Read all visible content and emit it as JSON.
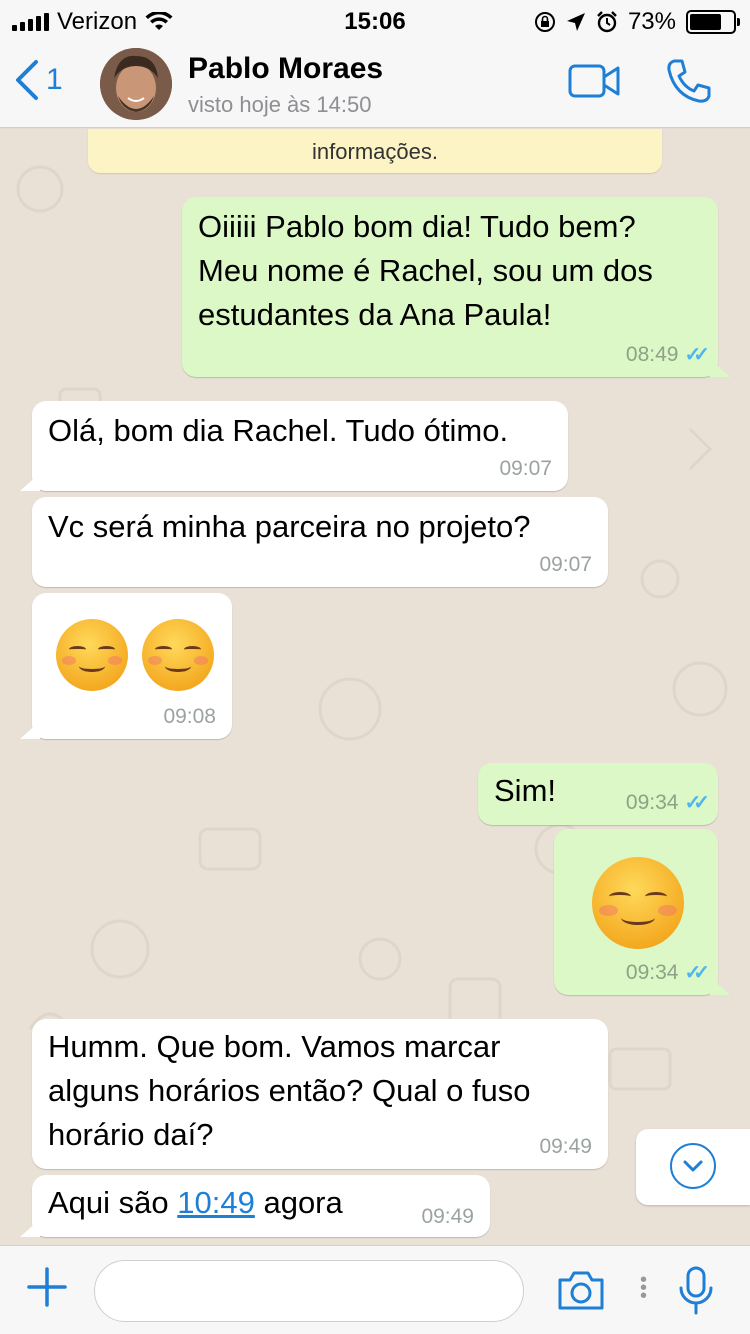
{
  "status_bar": {
    "carrier": "Verizon",
    "time": "15:06",
    "battery": "73%",
    "battery_level": 0.73
  },
  "header": {
    "back_count": "1",
    "contact_name": "Pablo Moraes",
    "contact_status": "visto hoje às 14:50"
  },
  "chat": {
    "system_message": "informações.",
    "messages": [
      {
        "dir": "out",
        "lines": [
          "Oiiiii Pablo bom dia! Tudo bem?",
          "Meu nome é Rachel, sou um dos",
          "estudantes da Ana Paula!"
        ],
        "time": "08:49"
      },
      {
        "dir": "in",
        "text": "Olá, bom dia Rachel. Tudo ótimo.",
        "time": "09:07"
      },
      {
        "dir": "in",
        "text": "Vc será minha parceira no projeto?",
        "time": "09:07"
      },
      {
        "dir": "in",
        "emoji": "smiling-face-with-blush x2",
        "time": "09:08"
      },
      {
        "dir": "out",
        "text": "Sim!",
        "time": "09:34"
      },
      {
        "dir": "out",
        "emoji": "smiling-face-with-blush",
        "time": "09:34"
      },
      {
        "dir": "in",
        "lines": [
          "Humm. Que bom. Vamos marcar",
          "alguns horários então? Qual o fuso",
          "horário daí?"
        ],
        "time": "09:49"
      },
      {
        "dir": "in",
        "text_before": "Aqui são ",
        "link": "10:49",
        "text_after": " agora",
        "time": "09:49"
      }
    ]
  },
  "colors": {
    "accent": "#1e7fd6",
    "outgoing_bubble": "#dcf8c6",
    "incoming_bubble": "#ffffff",
    "read_ticks": "#4fb6ec",
    "system_bubble": "#fdf4c5"
  }
}
